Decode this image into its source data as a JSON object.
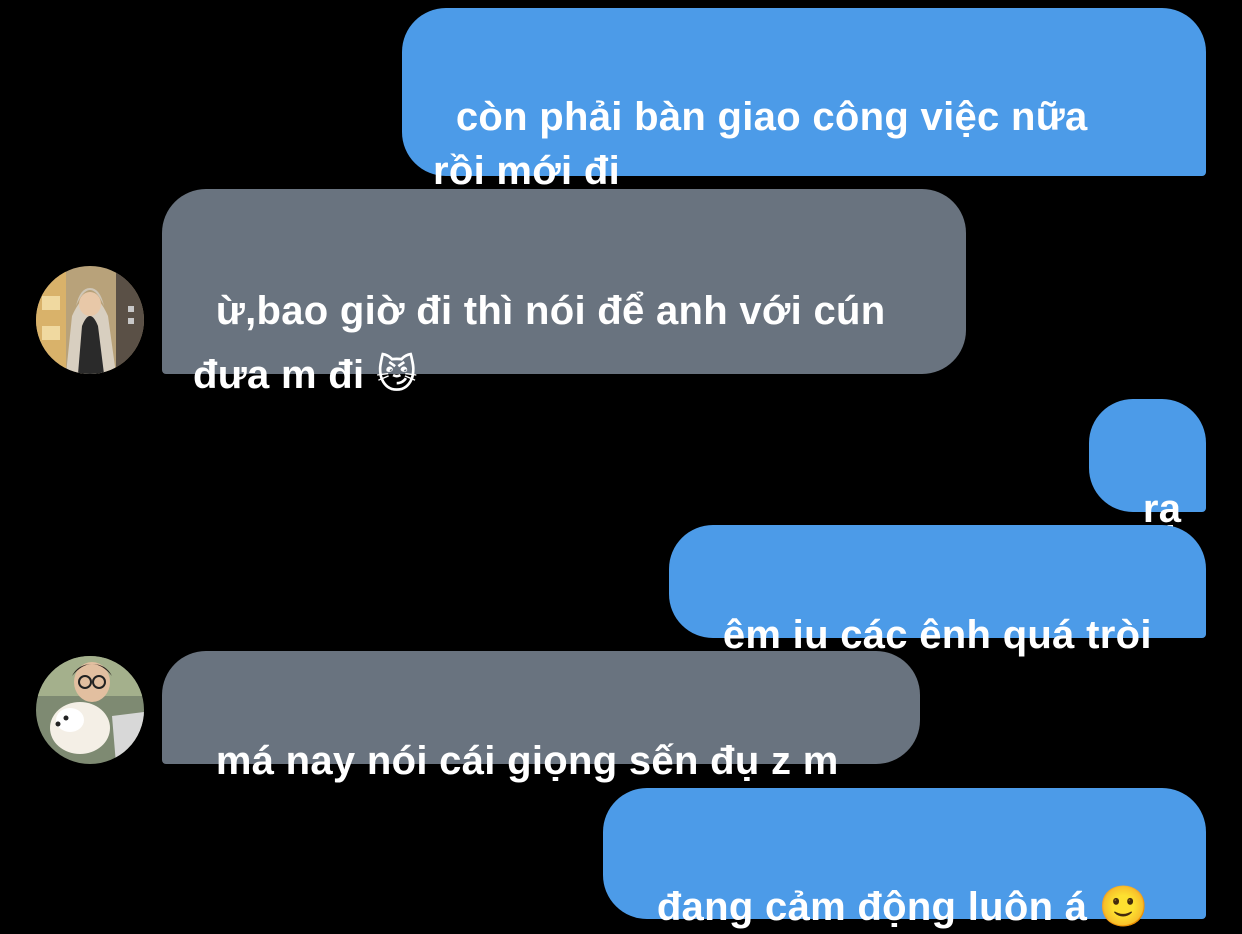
{
  "conversation": {
    "messages": [
      {
        "from": "me",
        "text": "còn phải bàn giao công việc nữa\nrồi mới đi"
      },
      {
        "from": "contact",
        "text": "ừ,bao giờ đi thì nói để anh với cún\nđưa m đi",
        "emoji": "😼"
      },
      {
        "from": "me",
        "text": "rạ"
      },
      {
        "from": "me",
        "text": "êm iu các ênh quá tròi"
      },
      {
        "from": "contact",
        "text": "má nay nói cái giọng sến đụ z m"
      },
      {
        "from": "me",
        "text": "đang cảm động luôn á",
        "emoji": "🙂"
      }
    ]
  },
  "colors": {
    "background": "#000000",
    "sent_bubble": "#4c9be8",
    "received_bubble": "#69737f",
    "text": "#ffffff"
  }
}
